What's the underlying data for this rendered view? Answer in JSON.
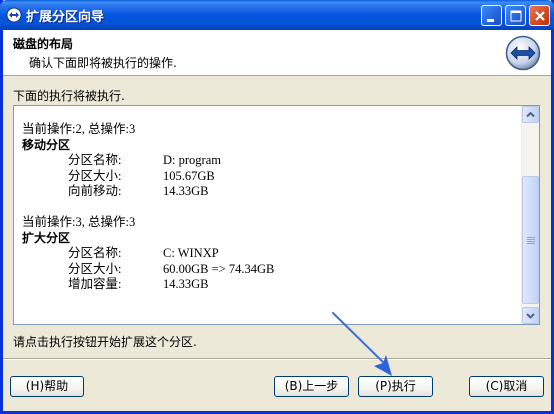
{
  "window": {
    "title": "扩展分区向导"
  },
  "header": {
    "title": "磁盘的布局",
    "subtitle": "确认下面即将被执行的操作."
  },
  "intro": "下面的执行将被执行.",
  "operations": [
    {
      "heading": "当前操作:2, 总操作:3",
      "name": "移动分区",
      "fields": [
        {
          "key": "分区名称:",
          "value": "D: program"
        },
        {
          "key": "分区大小:",
          "value": "105.67GB"
        },
        {
          "key": "向前移动:",
          "value": "14.33GB"
        }
      ]
    },
    {
      "heading": "当前操作:3, 总操作:3",
      "name": "扩大分区",
      "fields": [
        {
          "key": "分区名称:",
          "value": "C: WINXP"
        },
        {
          "key": "分区大小:",
          "value": "60.00GB => 74.34GB"
        },
        {
          "key": "增加容量:",
          "value": "14.33GB"
        }
      ]
    }
  ],
  "hint": "请点击执行按钮开始扩展这个分区.",
  "buttons": {
    "help": "(H)帮助",
    "back": "(B)上一步",
    "execute": "(P)执行",
    "cancel": "(C)取消"
  },
  "icons": {
    "title": "partition-wizard-icon",
    "header": "resize-arrows-icon",
    "annotation": "pointer-arrow-annotation"
  },
  "colors": {
    "titlebar": "#0556e0",
    "face": "#ece9d8",
    "annotation": "#3a6ee0"
  }
}
